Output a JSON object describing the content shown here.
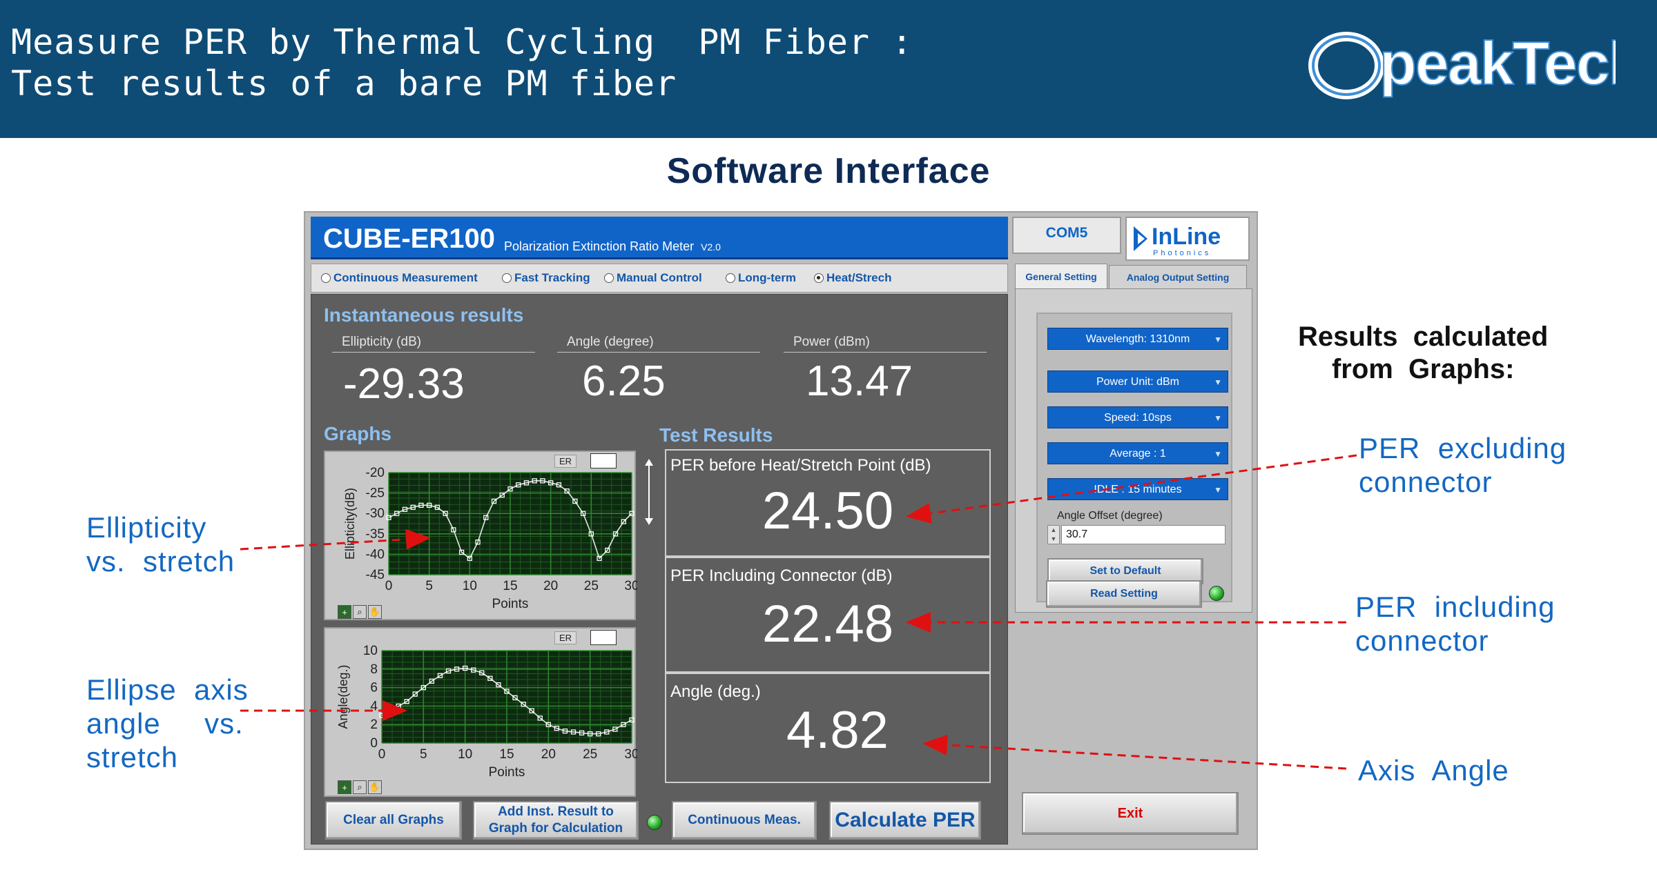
{
  "slide": {
    "title_line1": "Measure PER by Thermal Cycling  PM Fiber :",
    "title_line2": "Test results of a bare PM fiber",
    "logo_text": "OpeakTech",
    "subtitle": "Software Interface"
  },
  "app": {
    "name": "CUBE-ER100",
    "description": "Polarization Extinction Ratio Meter",
    "version": "V2.0",
    "com_port": "COM5",
    "brand_name": "InLine",
    "brand_sub": "Photonics",
    "modes": [
      {
        "label": "Continuous Measurement",
        "selected": false
      },
      {
        "label": "Fast Tracking",
        "selected": false
      },
      {
        "label": "Manual Control",
        "selected": false
      },
      {
        "label": "Long-term",
        "selected": false
      },
      {
        "label": "Heat/Strech",
        "selected": true
      }
    ],
    "instantaneous": {
      "heading": "Instantaneous results",
      "ellipticity_label": "Ellipticity (dB)",
      "ellipticity_value": "-29.33",
      "angle_label": "Angle (degree)",
      "angle_value": "6.25",
      "power_label": "Power (dBm)",
      "power_value": "13.47"
    },
    "graphs_heading": "Graphs",
    "graph_tag": "ER",
    "test_results": {
      "heading": "Test Results",
      "per_before_label": "PER before Heat/Stretch Point (dB)",
      "per_before_value": "24.50",
      "per_incl_label": "PER Including Connector (dB)",
      "per_incl_value": "22.48",
      "angle_label": "Angle (deg.)",
      "angle_value": "4.82"
    },
    "buttons": {
      "clear": "Clear  all Graphs",
      "add": "Add Inst. Result to Graph for Calculation",
      "continuous": "Continuous Meas.",
      "calculate": "Calculate PER",
      "set_default": "Set to Default",
      "read_setting": "Read Setting",
      "exit": "Exit"
    },
    "side": {
      "tab_general": "General Setting",
      "tab_analog": "Analog Output Setting",
      "wavelength": "Wavelength: 1310nm",
      "power_unit": "Power Unit: dBm",
      "speed": "Speed: 10sps",
      "average": "Average : 1",
      "idle": "IDLE : 15 minutes",
      "offset_label": "Angle Offset (degree)",
      "offset_value": "30.7"
    }
  },
  "annotations": {
    "ellipticity": "Ellipticity\nvs.  stretch",
    "ellipse_axis": "Ellipse  axis\nangle     vs.\nstretch",
    "results_calc": "Results  calculated\nfrom  Graphs:",
    "per_excluding": "PER  excluding\nconnector",
    "per_including": "PER  including\nconnector",
    "axis_angle": "Axis  Angle"
  },
  "colors": {
    "header_bg": "#0e4c76",
    "annotation_blue": "#1368c2",
    "arrow_red": "#e01010",
    "app_blue": "#1064c8",
    "plot_bg": "#0d2a10",
    "grid_green": "#2f8a2f"
  },
  "chart_data": [
    {
      "type": "line",
      "title": "",
      "xlabel": "Points",
      "ylabel": "Ellipticity(dB)",
      "xlim": [
        0,
        30
      ],
      "ylim": [
        -45,
        -20
      ],
      "xticks": [
        0,
        5,
        10,
        15,
        20,
        25,
        30
      ],
      "yticks": [
        -20,
        -25,
        -30,
        -35,
        -40,
        -45
      ],
      "grid": true,
      "series": [
        {
          "x": [
            0,
            1,
            2,
            3,
            4,
            5,
            6,
            7,
            8,
            9,
            10,
            11,
            12,
            13,
            14,
            15,
            16,
            17,
            18,
            19,
            20,
            21,
            22,
            23,
            24,
            25,
            26,
            27,
            28,
            29,
            30
          ],
          "values": [
            -31,
            -30,
            -29,
            -28.5,
            -28,
            -28,
            -28.5,
            -30,
            -34,
            -39.5,
            -41,
            -37,
            -31,
            -27,
            -25.5,
            -24,
            -23,
            -22.5,
            -22,
            -22,
            -22.5,
            -23,
            -24.5,
            -27,
            -30,
            -35,
            -41,
            -39,
            -35,
            -32,
            -30
          ]
        }
      ]
    },
    {
      "type": "line",
      "title": "",
      "xlabel": "Points",
      "ylabel": "Angle(deg.)",
      "xlim": [
        0,
        30
      ],
      "ylim": [
        0,
        10
      ],
      "xticks": [
        0,
        5,
        10,
        15,
        20,
        25,
        30
      ],
      "yticks": [
        10,
        8,
        6,
        4,
        2,
        0
      ],
      "grid": true,
      "series": [
        {
          "x": [
            0,
            1,
            2,
            3,
            4,
            5,
            6,
            7,
            8,
            9,
            10,
            11,
            12,
            13,
            14,
            15,
            16,
            17,
            18,
            19,
            20,
            21,
            22,
            23,
            24,
            25,
            26,
            27,
            28,
            29,
            30
          ],
          "values": [
            3,
            3.5,
            4,
            4.5,
            5.3,
            6,
            6.7,
            7.3,
            7.8,
            8,
            8.1,
            7.9,
            7.6,
            7,
            6.3,
            5.6,
            4.9,
            4.2,
            3.5,
            2.7,
            2,
            1.6,
            1.3,
            1.2,
            1.1,
            1,
            1,
            1.2,
            1.5,
            2,
            2.5
          ]
        }
      ]
    }
  ]
}
